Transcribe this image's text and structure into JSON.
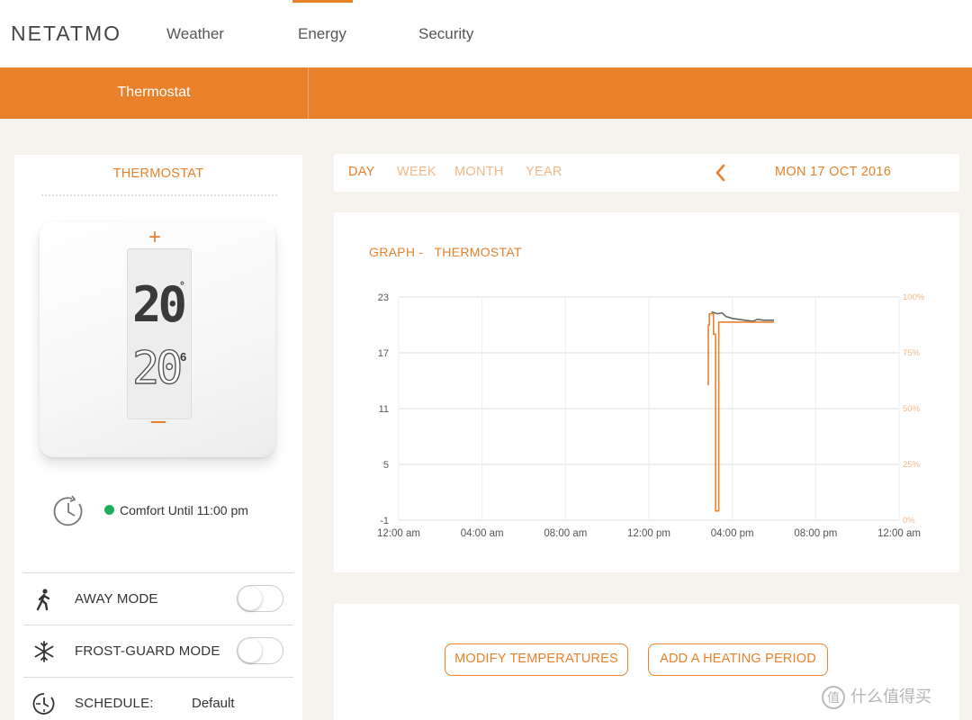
{
  "nav": {
    "logo": "NETATMO",
    "links": [
      "Weather",
      "Energy",
      "Security"
    ],
    "active": "Energy"
  },
  "subnav": {
    "tab": "Thermostat"
  },
  "thermostat_panel": {
    "title": "THERMOSTAT",
    "setpoint": "20",
    "setpoint_unit": "°",
    "current_temp": "20",
    "current_temp_decimal": "6",
    "plus_icon": "plus-icon",
    "minus_icon": "minus-icon",
    "status_label": "Comfort",
    "status_until": "Until 11:00 pm",
    "status_color": "#1fae5c",
    "rows": [
      {
        "label": "AWAY MODE",
        "icon": "walking-person-icon",
        "toggle": false
      },
      {
        "label": "FROST-GUARD MODE",
        "icon": "snowflake-icon",
        "toggle": false
      },
      {
        "label": "SCHEDULE:",
        "icon": "schedule-clock-icon",
        "value": "Default"
      }
    ]
  },
  "period": {
    "tabs": [
      "DAY",
      "WEEK",
      "MONTH",
      "YEAR"
    ],
    "active": "DAY",
    "date": "MON 17 OCT 2016"
  },
  "graph": {
    "title_prefix": "GRAPH -",
    "title": "THERMOSTAT"
  },
  "chart_data": {
    "type": "line",
    "x_tick_labels": [
      "12:00 am",
      "04:00 am",
      "08:00 am",
      "12:00 pm",
      "04:00 pm",
      "08:00 pm",
      "12:00 am"
    ],
    "y_left_ticks": [
      "23",
      "17",
      "11",
      "5",
      "-1"
    ],
    "y_left_range": [
      -1,
      23
    ],
    "y_right_ticks": [
      "100%",
      "75%",
      "50%",
      "25%",
      "0%"
    ],
    "y_right_range": [
      0,
      100
    ],
    "grid": true,
    "series": [
      {
        "color": "#666666",
        "x_hours": [
          15.0,
          15.3,
          15.5,
          15.7,
          16.0,
          16.3,
          16.6,
          17.0,
          17.2,
          17.5,
          18.0
        ],
        "y": [
          21.4,
          21.2,
          21.3,
          20.9,
          20.7,
          20.6,
          20.5,
          20.4,
          20.6,
          20.5,
          20.5
        ]
      },
      {
        "color": "#e8812a",
        "x_hours": [
          14.85,
          14.85,
          14.9,
          14.9,
          15.1,
          15.1,
          15.2,
          15.2,
          15.35,
          15.35,
          16.0,
          17.0,
          18.0
        ],
        "y": [
          13.5,
          20.0,
          20.0,
          21.2,
          21.2,
          19.0,
          19.0,
          0.0,
          0.0,
          20.3,
          20.3,
          20.3,
          20.3
        ]
      }
    ]
  },
  "actions": {
    "modify": "MODIFY TEMPERATURES",
    "add_period": "ADD A HEATING PERIOD"
  },
  "watermark": {
    "icon": "值",
    "text": "什么值得买"
  },
  "colors": {
    "accent": "#e8812a",
    "background": "#f6f3ef"
  }
}
